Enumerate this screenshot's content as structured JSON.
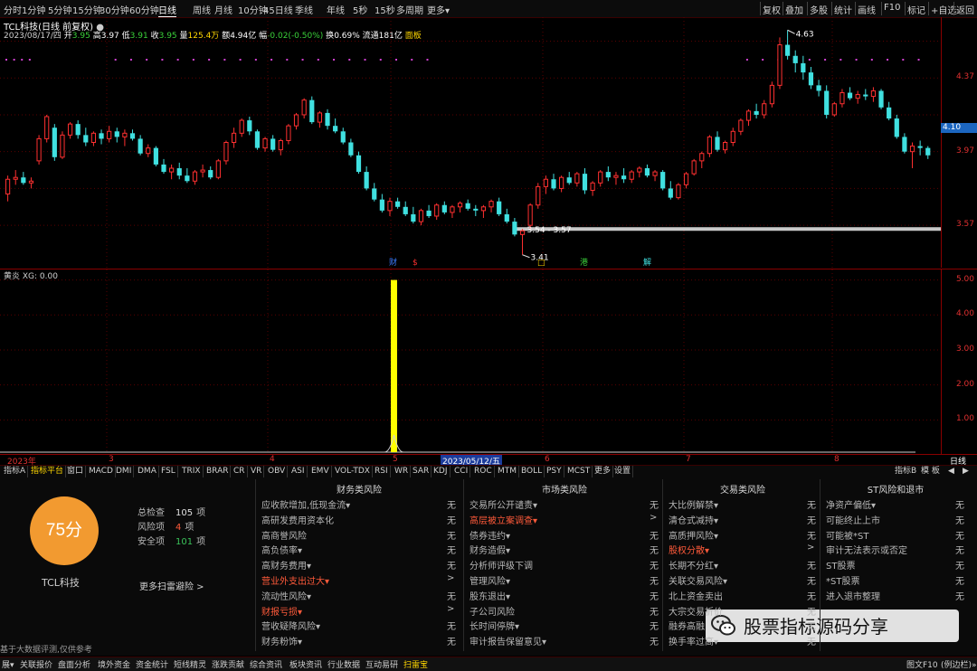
{
  "periods": [
    "分时",
    "1分钟",
    "5分钟",
    "15分钟",
    "30分钟",
    "60分钟",
    "日线",
    "周线",
    "月线",
    "10分钟",
    "45日线",
    "季线",
    "年线",
    "5秒",
    "15秒",
    "多周期",
    "更多▾"
  ],
  "active_period": "日线",
  "right_buttons": [
    "复权",
    "叠加",
    "多股",
    "统计",
    "画线",
    "F10",
    "标记",
    "+自选",
    "返回"
  ],
  "stock_title": "TCL科技(日线 前复权)",
  "info": {
    "date": "2023/08/17/四",
    "open_label": "开",
    "open": "3.95",
    "high_label": "高",
    "high": "3.97",
    "low_label": "低",
    "low": "3.91",
    "close_label": "收",
    "close": "3.95",
    "vol_label": "量",
    "vol": "125.4万",
    "amt_label": "额",
    "amt": "4.94亿",
    "chg_label": "幅",
    "chg": "-0.02(-0.50%)",
    "turn_label": "换",
    "turn": "0.69%",
    "float_label": "流通",
    "float": "181亿",
    "panel_label": "面板"
  },
  "price_axis": [
    "4.37",
    "3.97",
    "3.57"
  ],
  "current_price": "4.10",
  "annotations": {
    "high": "4.63",
    "low": "3.41",
    "range": "3.54 - 3.57"
  },
  "event_markers": [
    "财",
    "$",
    "□",
    "港",
    "解"
  ],
  "indicator": {
    "title": "黄炎 XG: 0.00",
    "axis": [
      "5.00",
      "4.00",
      "3.00",
      "2.00",
      "1.00"
    ]
  },
  "date_strip": {
    "labels": [
      "2023年",
      "3",
      "4",
      "5",
      "6",
      "7",
      "8"
    ],
    "highlight": "2023/05/12/五",
    "period": "日线"
  },
  "indicator_tabs": [
    "指标A",
    "指标平台",
    "窗口",
    "MACD",
    "DMI",
    "DMA",
    "FSL",
    "TRIX",
    "BRAR",
    "CR",
    "VR",
    "OBV",
    "ASI",
    "EMV",
    "VOL-TDX",
    "RSI",
    "WR",
    "SAR",
    "KDJ",
    "CCI",
    "ROC",
    "MTM",
    "BOLL",
    "PSY",
    "MCST",
    "更多",
    "设置"
  ],
  "tabs_right": [
    "指标B",
    "模 板",
    "◀",
    "▶"
  ],
  "score": {
    "value": "75分",
    "stock": "TCL科技",
    "more": "更多扫雷避险 >",
    "stats": [
      {
        "label": "总检查",
        "value": "105",
        "unit": "项",
        "color": "#e0e0e0"
      },
      {
        "label": "风险项",
        "value": "4",
        "unit": "项",
        "color": "#ff5a3a"
      },
      {
        "label": "安全项",
        "value": "101",
        "unit": "项",
        "color": "#3ac25a"
      }
    ]
  },
  "risk_columns": [
    {
      "title": "财务类风险",
      "items": [
        {
          "label": "应收款增加,低现金流▾",
          "result": "无",
          "warn": false
        },
        {
          "label": "高研发费用资本化",
          "result": "无",
          "warn": false
        },
        {
          "label": "高商誉风险",
          "result": "无",
          "warn": false
        },
        {
          "label": "高负债率▾",
          "result": "无",
          "warn": false
        },
        {
          "label": "高财务费用▾",
          "result": "无",
          "warn": false
        },
        {
          "label": "营业外支出过大▾",
          "result": ">",
          "warn": true
        },
        {
          "label": "流动性风险▾",
          "result": "无",
          "warn": false
        },
        {
          "label": "财报亏损▾",
          "result": ">",
          "warn": true
        },
        {
          "label": "营收疑降风险▾",
          "result": "无",
          "warn": false
        },
        {
          "label": "财务粉饰▾",
          "result": "无",
          "warn": false
        }
      ]
    },
    {
      "title": "市场类风险",
      "items": [
        {
          "label": "交易所公开谴责▾",
          "result": "无",
          "warn": false
        },
        {
          "label": "高层被立案调查▾",
          "result": ">",
          "warn": true
        },
        {
          "label": "债券违约▾",
          "result": "无",
          "warn": false
        },
        {
          "label": "财务造假▾",
          "result": "无",
          "warn": false
        },
        {
          "label": "分析师评级下调",
          "result": "无",
          "warn": false
        },
        {
          "label": "管理风险▾",
          "result": "无",
          "warn": false
        },
        {
          "label": "股东退出▾",
          "result": "无",
          "warn": false
        },
        {
          "label": "子公司风险",
          "result": "无",
          "warn": false
        },
        {
          "label": "长时间停牌▾",
          "result": "无",
          "warn": false
        },
        {
          "label": "审计报告保留意见▾",
          "result": "无",
          "warn": false
        }
      ]
    },
    {
      "title": "交易类风险",
      "items": [
        {
          "label": "大比例解禁▾",
          "result": "无",
          "warn": false
        },
        {
          "label": "清仓式减持▾",
          "result": "无",
          "warn": false
        },
        {
          "label": "高质押风险▾",
          "result": "无",
          "warn": false
        },
        {
          "label": "股权分散▾",
          "result": ">",
          "warn": true
        },
        {
          "label": "长期不分红▾",
          "result": "无",
          "warn": false
        },
        {
          "label": "关联交易风险▾",
          "result": "无",
          "warn": false
        },
        {
          "label": "北上资金卖出",
          "result": "无",
          "warn": false
        },
        {
          "label": "大宗交易折价",
          "result": "无",
          "warn": false
        },
        {
          "label": "融券高融",
          "result": "无",
          "warn": false
        },
        {
          "label": "换手率过高▾",
          "result": "无",
          "warn": false
        }
      ]
    },
    {
      "title": "ST风险和退市",
      "items": [
        {
          "label": "净资产偏低▾",
          "result": "无",
          "warn": false
        },
        {
          "label": "可能终止上市",
          "result": "无",
          "warn": false
        },
        {
          "label": "可能被*ST",
          "result": "无",
          "warn": false
        },
        {
          "label": "审计无法表示或否定",
          "result": "无",
          "warn": false
        },
        {
          "label": "ST股票",
          "result": "无",
          "warn": false
        },
        {
          "label": "*ST股票",
          "result": "无",
          "warn": false
        },
        {
          "label": "进入退市整理",
          "result": "无",
          "warn": false
        }
      ]
    }
  ],
  "disclaimer": "基于大数据评测,仅供参考",
  "status_items": [
    "展▾",
    "关联报价",
    "盘面分析",
    "境外资金",
    "资金统计",
    "短线精灵",
    "涨跌贡献",
    "综合资讯",
    "板块资讯",
    "行业数据",
    "互动易研",
    "扫雷宝"
  ],
  "status_active": "扫雷宝",
  "status_right": "图文F10",
  "status_right2": "(例边栏)»",
  "watermark": "股票指标源码分享",
  "colors": {
    "up": "#ff3030",
    "down": "#40e0e0",
    "axis": "#8a0000",
    "score": "#f29a30",
    "signal": "#ffff00"
  },
  "chart_data": {
    "type": "candlestick",
    "ylim": [
      3.34,
      4.7
    ],
    "ohlc": [
      [
        3.74,
        3.84,
        3.7,
        3.82
      ],
      [
        3.82,
        3.87,
        3.79,
        3.83
      ],
      [
        3.83,
        3.86,
        3.79,
        3.8
      ],
      [
        3.8,
        3.83,
        3.77,
        3.81
      ],
      [
        3.92,
        4.06,
        3.9,
        4.04
      ],
      [
        4.04,
        4.17,
        4.02,
        4.16
      ],
      [
        4.1,
        4.12,
        3.92,
        3.94
      ],
      [
        3.94,
        4.08,
        3.93,
        4.06
      ],
      [
        4.06,
        4.13,
        4.04,
        4.12
      ],
      [
        4.12,
        4.14,
        4.04,
        4.06
      ],
      [
        4.06,
        4.1,
        4.0,
        4.02
      ],
      [
        4.02,
        4.08,
        4.0,
        4.07
      ],
      [
        4.07,
        4.09,
        4.01,
        4.04
      ],
      [
        4.04,
        4.11,
        4.02,
        4.08
      ],
      [
        4.08,
        4.1,
        4.02,
        4.05
      ],
      [
        4.05,
        4.09,
        4.0,
        4.07
      ],
      [
        4.07,
        4.09,
        4.03,
        4.04
      ],
      [
        4.04,
        4.06,
        3.95,
        3.96
      ],
      [
        3.96,
        4.01,
        3.94,
        3.99
      ],
      [
        3.99,
        4.0,
        3.89,
        3.9
      ],
      [
        3.9,
        3.93,
        3.85,
        3.86
      ],
      [
        3.86,
        3.9,
        3.82,
        3.88
      ],
      [
        3.88,
        3.91,
        3.82,
        3.84
      ],
      [
        3.84,
        3.88,
        3.8,
        3.81
      ],
      [
        3.81,
        3.87,
        3.79,
        3.86
      ],
      [
        3.86,
        3.9,
        3.83,
        3.87
      ],
      [
        3.87,
        3.89,
        3.82,
        3.83
      ],
      [
        3.83,
        3.93,
        3.82,
        3.92
      ],
      [
        3.92,
        4.03,
        3.9,
        4.02
      ],
      [
        4.02,
        4.1,
        3.99,
        4.07
      ],
      [
        4.07,
        4.15,
        4.05,
        4.14
      ],
      [
        4.14,
        4.16,
        4.06,
        4.08
      ],
      [
        4.08,
        4.09,
        3.98,
        3.99
      ],
      [
        3.99,
        4.05,
        3.97,
        4.04
      ],
      [
        4.04,
        4.06,
        3.97,
        3.98
      ],
      [
        3.98,
        4.04,
        3.95,
        4.03
      ],
      [
        4.03,
        4.12,
        4.01,
        4.11
      ],
      [
        4.11,
        4.18,
        4.09,
        4.17
      ],
      [
        4.17,
        4.26,
        4.15,
        4.25
      ],
      [
        4.25,
        4.27,
        4.12,
        4.13
      ],
      [
        4.13,
        4.19,
        4.1,
        4.18
      ],
      [
        4.18,
        4.2,
        4.09,
        4.11
      ],
      [
        4.11,
        4.15,
        4.07,
        4.08
      ],
      [
        4.08,
        4.1,
        4.01,
        4.02
      ],
      [
        4.02,
        4.04,
        3.94,
        3.95
      ],
      [
        3.95,
        3.97,
        3.85,
        3.86
      ],
      [
        3.86,
        3.89,
        3.76,
        3.77
      ],
      [
        3.77,
        3.8,
        3.7,
        3.71
      ],
      [
        3.71,
        3.74,
        3.64,
        3.65
      ],
      [
        3.65,
        3.72,
        3.62,
        3.7
      ],
      [
        3.7,
        3.72,
        3.66,
        3.67
      ],
      [
        3.67,
        3.7,
        3.62,
        3.63
      ],
      [
        3.63,
        3.67,
        3.58,
        3.59
      ],
      [
        3.59,
        3.66,
        3.57,
        3.65
      ],
      [
        3.65,
        3.68,
        3.61,
        3.62
      ],
      [
        3.62,
        3.69,
        3.6,
        3.68
      ],
      [
        3.68,
        3.7,
        3.63,
        3.64
      ],
      [
        3.64,
        3.68,
        3.61,
        3.67
      ],
      [
        3.67,
        3.7,
        3.64,
        3.69
      ],
      [
        3.69,
        3.71,
        3.65,
        3.66
      ],
      [
        3.66,
        3.68,
        3.62,
        3.65
      ],
      [
        3.65,
        3.68,
        3.61,
        3.67
      ],
      [
        3.67,
        3.71,
        3.64,
        3.7
      ],
      [
        3.7,
        3.72,
        3.62,
        3.63
      ],
      [
        3.63,
        3.66,
        3.58,
        3.59
      ],
      [
        3.59,
        3.61,
        3.51,
        3.52
      ],
      [
        3.52,
        3.55,
        3.41,
        3.54
      ],
      [
        3.57,
        3.69,
        3.55,
        3.68
      ],
      [
        3.68,
        3.8,
        3.66,
        3.78
      ],
      [
        3.78,
        3.84,
        3.74,
        3.82
      ],
      [
        3.82,
        3.85,
        3.76,
        3.77
      ],
      [
        3.77,
        3.84,
        3.75,
        3.83
      ],
      [
        3.83,
        3.86,
        3.79,
        3.8
      ],
      [
        3.8,
        3.86,
        3.78,
        3.85
      ],
      [
        3.85,
        3.88,
        3.74,
        3.76
      ],
      [
        3.76,
        3.81,
        3.73,
        3.8
      ],
      [
        3.8,
        3.87,
        3.78,
        3.86
      ],
      [
        3.86,
        3.89,
        3.81,
        3.83
      ],
      [
        3.83,
        3.86,
        3.79,
        3.84
      ],
      [
        3.84,
        3.88,
        3.8,
        3.82
      ],
      [
        3.82,
        3.87,
        3.8,
        3.86
      ],
      [
        3.86,
        3.89,
        3.83,
        3.88
      ],
      [
        3.88,
        3.9,
        3.83,
        3.84
      ],
      [
        3.84,
        3.87,
        3.81,
        3.86
      ],
      [
        3.86,
        3.87,
        3.76,
        3.77
      ],
      [
        3.77,
        3.81,
        3.71,
        3.72
      ],
      [
        3.72,
        3.8,
        3.71,
        3.79
      ],
      [
        3.79,
        3.86,
        3.77,
        3.85
      ],
      [
        3.85,
        3.93,
        3.84,
        3.92
      ],
      [
        3.92,
        3.97,
        3.88,
        3.96
      ],
      [
        3.96,
        4.06,
        3.94,
        4.05
      ],
      [
        4.05,
        4.08,
        3.97,
        3.98
      ],
      [
        3.98,
        4.03,
        3.96,
        4.02
      ],
      [
        4.02,
        4.1,
        4.0,
        4.08
      ],
      [
        4.08,
        4.15,
        4.06,
        4.14
      ],
      [
        4.14,
        4.2,
        4.11,
        4.19
      ],
      [
        4.19,
        4.23,
        4.15,
        4.17
      ],
      [
        4.17,
        4.25,
        4.15,
        4.23
      ],
      [
        4.23,
        4.35,
        4.21,
        4.33
      ],
      [
        4.33,
        4.59,
        4.31,
        4.55
      ],
      [
        4.55,
        4.63,
        4.47,
        4.49
      ],
      [
        4.49,
        4.52,
        4.4,
        4.45
      ],
      [
        4.45,
        4.49,
        4.36,
        4.4
      ],
      [
        4.4,
        4.43,
        4.31,
        4.33
      ],
      [
        4.33,
        4.36,
        4.27,
        4.3
      ],
      [
        4.3,
        4.33,
        4.15,
        4.17
      ],
      [
        4.17,
        4.24,
        4.16,
        4.23
      ],
      [
        4.23,
        4.31,
        4.21,
        4.29
      ],
      [
        4.29,
        4.32,
        4.25,
        4.26
      ],
      [
        4.26,
        4.3,
        4.23,
        4.28
      ],
      [
        4.28,
        4.31,
        4.25,
        4.27
      ],
      [
        4.27,
        4.32,
        4.24,
        4.3
      ],
      [
        4.3,
        4.31,
        4.2,
        4.21
      ],
      [
        4.21,
        4.24,
        4.14,
        4.15
      ],
      [
        4.15,
        4.17,
        4.04,
        4.05
      ],
      [
        4.05,
        4.07,
        3.96,
        3.97
      ],
      [
        3.97,
        4.02,
        3.88,
        4.0
      ],
      [
        4.0,
        4.03,
        3.95,
        3.99
      ],
      [
        3.99,
        4.0,
        3.93,
        3.95
      ]
    ],
    "levels": [
      3.55
    ],
    "indicator": {
      "ylim": [
        0,
        5.3
      ],
      "spike_index": 67,
      "spike_value": 5.0
    }
  }
}
